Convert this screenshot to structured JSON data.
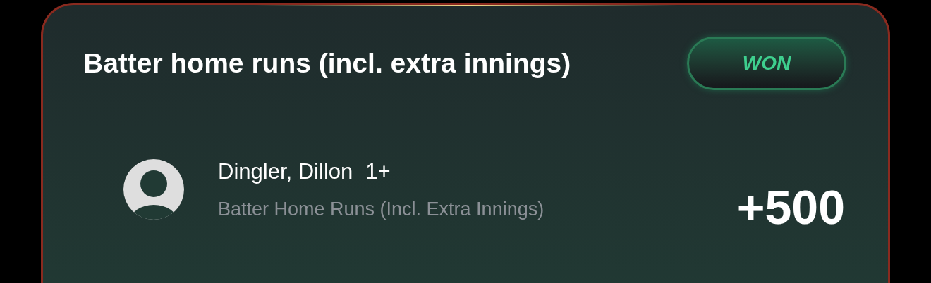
{
  "market": {
    "title": "Batter home runs (incl. extra innings)",
    "status": {
      "kind": "won",
      "label": "WON"
    }
  },
  "selection": {
    "name": "Dingler, Dillon",
    "line": "1+",
    "market_name": "Batter Home Runs (Incl. Extra Innings)",
    "odds": "+500"
  }
}
